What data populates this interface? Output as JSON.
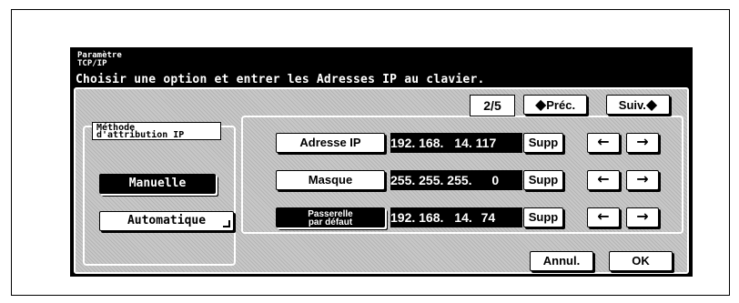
{
  "header": {
    "title_line1": "Paramètre",
    "title_line2": "TCP/IP",
    "instruction": "Choisir une option et entrer les Adresses IP au clavier."
  },
  "pager": {
    "indicator": "2/5",
    "prev_label": "Préc.",
    "next_label": "Suiv."
  },
  "method": {
    "label_line1": "Méthode",
    "label_line2": "d'attribution IP",
    "options": [
      {
        "label": "Manuelle",
        "selected": true
      },
      {
        "label": "Automatique",
        "selected": false
      }
    ]
  },
  "rows": [
    {
      "label": "Adresse IP",
      "octets": [
        "192.",
        "168.",
        "14.",
        "117"
      ],
      "supp": "Supp",
      "selected": false
    },
    {
      "label": "Masque",
      "octets": [
        "255.",
        "255.",
        "255.",
        "0"
      ],
      "supp": "Supp",
      "selected": false
    },
    {
      "label_line1": "Passerelle",
      "label_line2": "par défaut",
      "octets": [
        "192.",
        "168.",
        "14.",
        "74"
      ],
      "supp": "Supp",
      "selected": true
    }
  ],
  "arrows": {
    "left": "←",
    "right": "→"
  },
  "footer": {
    "cancel_label": "Annul.",
    "ok_label": "OK"
  }
}
